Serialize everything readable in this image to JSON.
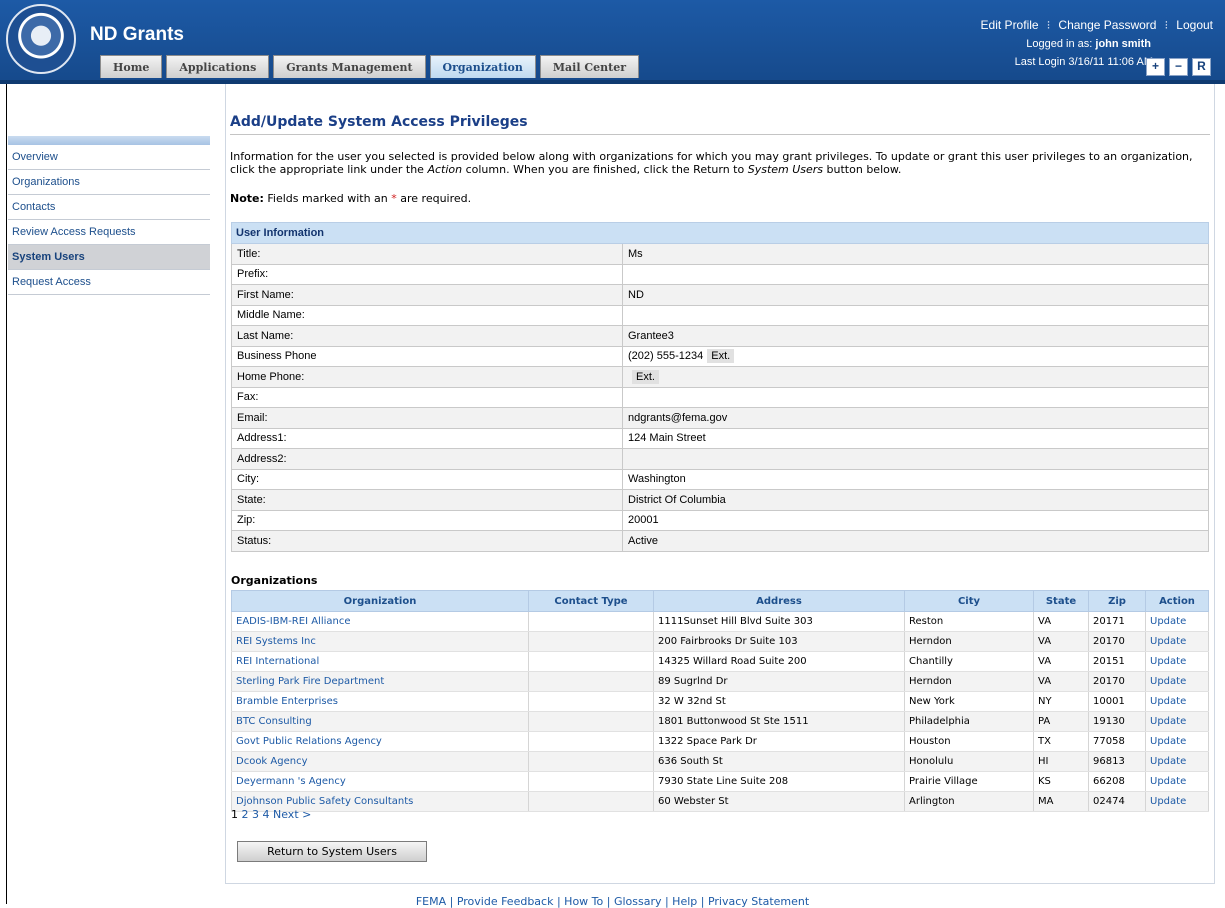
{
  "header": {
    "app_title": "ND Grants",
    "edit_profile": "Edit Profile",
    "change_password": "Change Password",
    "logout": "Logout",
    "logged_in_label": "Logged in as:",
    "logged_in_user": "john smith",
    "last_login": "Last Login 3/16/11 11:06 AM",
    "font_plus": "+",
    "font_minus": "−",
    "font_reset": "R"
  },
  "tabs": [
    {
      "label": "Home"
    },
    {
      "label": "Applications"
    },
    {
      "label": "Grants Management"
    },
    {
      "label": "Organization"
    },
    {
      "label": "Mail Center"
    }
  ],
  "sidebar": {
    "items": [
      {
        "label": "Overview"
      },
      {
        "label": "Organizations"
      },
      {
        "label": "Contacts"
      },
      {
        "label": "Review Access Requests"
      },
      {
        "label": "System Users"
      },
      {
        "label": "Request Access"
      }
    ]
  },
  "page": {
    "title": "Add/Update System Access Privileges",
    "intro_a": "Information for the user you selected is provided below along with organizations for which you may grant privileges. To update or grant this user privileges to an organization, click the appropriate link under the ",
    "intro_action": "Action",
    "intro_b": " column. When you are finished, click the Return to ",
    "intro_system_users": "System Users",
    "intro_c": " button below.",
    "note_label": "Note:",
    "note_a": " Fields marked with an ",
    "note_star": "*",
    "note_b": " are required."
  },
  "user_info": {
    "heading": "User Information",
    "rows": [
      {
        "label": "Title:",
        "value": "Ms"
      },
      {
        "label": "Prefix:",
        "value": ""
      },
      {
        "label": "First Name:",
        "value": "ND"
      },
      {
        "label": "Middle Name:",
        "value": ""
      },
      {
        "label": "Last Name:",
        "value": "Grantee3"
      },
      {
        "label": "Business Phone",
        "value": "(202) 555-1234",
        "ext": "Ext."
      },
      {
        "label": "Home Phone:",
        "value": "",
        "ext": "Ext."
      },
      {
        "label": "Fax:",
        "value": ""
      },
      {
        "label": "Email:",
        "value": "ndgrants@fema.gov"
      },
      {
        "label": "Address1:",
        "value": "124 Main Street"
      },
      {
        "label": "Address2:",
        "value": ""
      },
      {
        "label": "City:",
        "value": "Washington"
      },
      {
        "label": "State:",
        "value": "District Of Columbia"
      },
      {
        "label": "Zip:",
        "value": "20001"
      },
      {
        "label": "Status:",
        "value": "Active"
      }
    ]
  },
  "organizations": {
    "caption": "Organizations",
    "columns": [
      "Organization",
      "Contact Type",
      "Address",
      "City",
      "State",
      "Zip",
      "Action"
    ],
    "rows": [
      {
        "org": "EADIS-IBM-REI Alliance",
        "contact": "",
        "address": "1111Sunset Hill Blvd Suite 303",
        "city": "Reston",
        "state": "VA",
        "zip": "20171",
        "action": "Update"
      },
      {
        "org": "REI Systems Inc",
        "contact": "",
        "address": "200 Fairbrooks Dr Suite 103",
        "city": "Herndon",
        "state": "VA",
        "zip": "20170",
        "action": "Update"
      },
      {
        "org": "REI International",
        "contact": "",
        "address": "14325 Willard Road Suite 200",
        "city": "Chantilly",
        "state": "VA",
        "zip": "20151",
        "action": "Update"
      },
      {
        "org": "Sterling Park Fire Department",
        "contact": "",
        "address": "89 Sugrlnd Dr",
        "city": "Herndon",
        "state": "VA",
        "zip": "20170",
        "action": "Update"
      },
      {
        "org": "Bramble Enterprises",
        "contact": "",
        "address": "32 W 32nd St",
        "city": "New York",
        "state": "NY",
        "zip": "10001",
        "action": "Update"
      },
      {
        "org": "BTC Consulting",
        "contact": "",
        "address": "1801 Buttonwood St Ste 1511",
        "city": "Philadelphia",
        "state": "PA",
        "zip": "19130",
        "action": "Update"
      },
      {
        "org": "Govt Public Relations Agency",
        "contact": "",
        "address": "1322 Space Park Dr",
        "city": "Houston",
        "state": "TX",
        "zip": "77058",
        "action": "Update"
      },
      {
        "org": "Dcook Agency",
        "contact": "",
        "address": "636 South St",
        "city": "Honolulu",
        "state": "HI",
        "zip": "96813",
        "action": "Update"
      },
      {
        "org": "Deyermann 's Agency",
        "contact": "",
        "address": "7930 State Line Suite 208",
        "city": "Prairie Village",
        "state": "KS",
        "zip": "66208",
        "action": "Update"
      },
      {
        "org": "Djohnson Public Safety Consultants",
        "contact": "",
        "address": "60 Webster St",
        "city": "Arlington",
        "state": "MA",
        "zip": "02474",
        "action": "Update"
      }
    ]
  },
  "pager": {
    "current": "1",
    "pages": [
      "2",
      "3",
      "4"
    ],
    "next": "Next >"
  },
  "return_button": "Return to System Users",
  "footer": {
    "text": "FEMA | Provide Feedback | How To | Glossary | Help | Privacy Statement"
  }
}
